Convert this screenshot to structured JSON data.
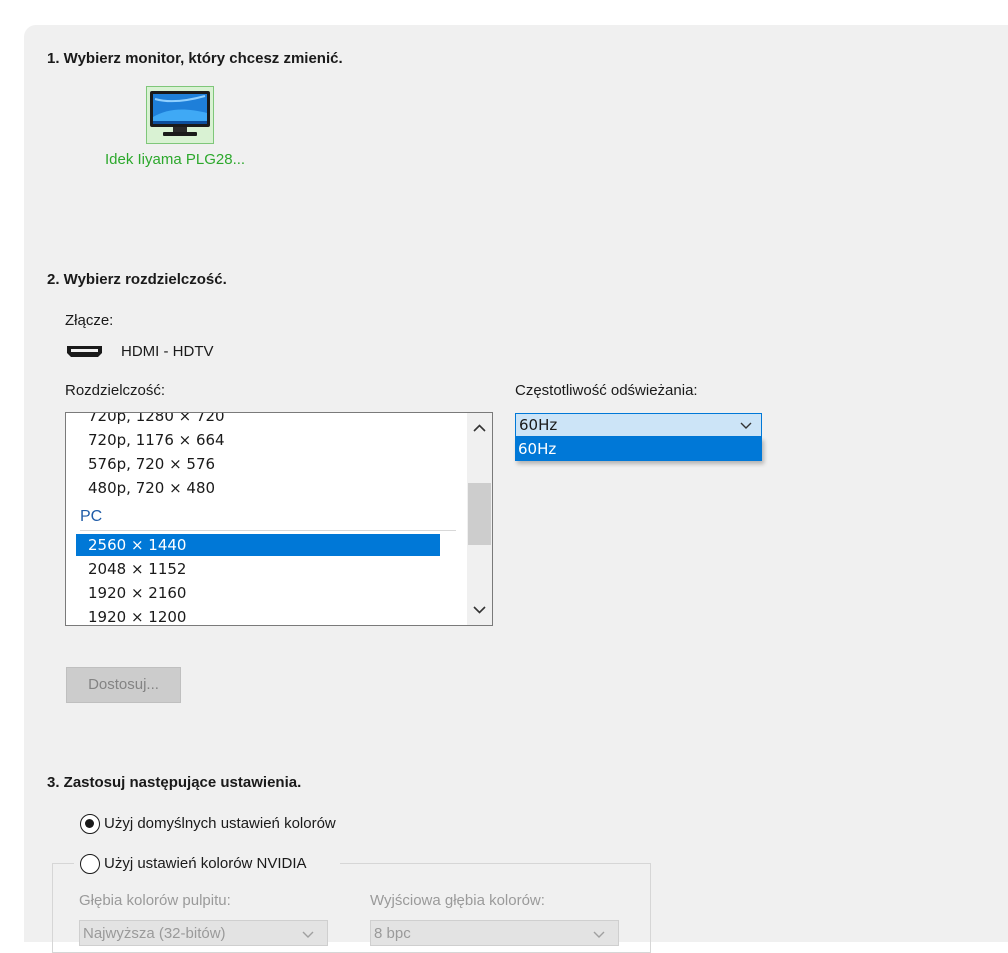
{
  "section1": {
    "heading": "1. Wybierz monitor, który chcesz zmienić.",
    "monitor_label": "Idek Iiyama PLG28..."
  },
  "section2": {
    "heading": "2. Wybierz rozdzielczość.",
    "connector_label": "Złącze:",
    "connector_value": "HDMI - HDTV",
    "resolution_label": "Rozdzielczość:",
    "resolutions": [
      "720p, 1280 × 720",
      "720p, 1176 × 664",
      "576p, 720 × 576",
      "480p, 720 × 480"
    ],
    "pc_group": "PC",
    "pc_resolutions": [
      "2560 × 1440",
      "2048 × 1152",
      "1920 × 2160",
      "1920 × 1200"
    ],
    "selected_resolution": "2560 × 1440",
    "refresh_label": "Częstotliwość odświeżania:",
    "refresh_value": "60Hz",
    "refresh_options": [
      "60Hz"
    ],
    "customize_button": "Dostosuj..."
  },
  "section3": {
    "heading": "3. Zastosuj następujące ustawienia.",
    "radio_default": "Użyj domyślnych ustawień kolorów",
    "radio_nvidia": "Użyj ustawień kolorów NVIDIA",
    "desktop_depth_label": "Głębia kolorów pulpitu:",
    "desktop_depth_value": "Najwyższa (32-bitów)",
    "output_depth_label": "Wyjściowa głębia kolorów:",
    "output_depth_value": "8 bpc"
  },
  "colors": {
    "accent": "#0078d7",
    "monitor_label": "#2ca82c",
    "group_header": "#1f5ca8",
    "panel_bg": "#f0f0f0"
  }
}
